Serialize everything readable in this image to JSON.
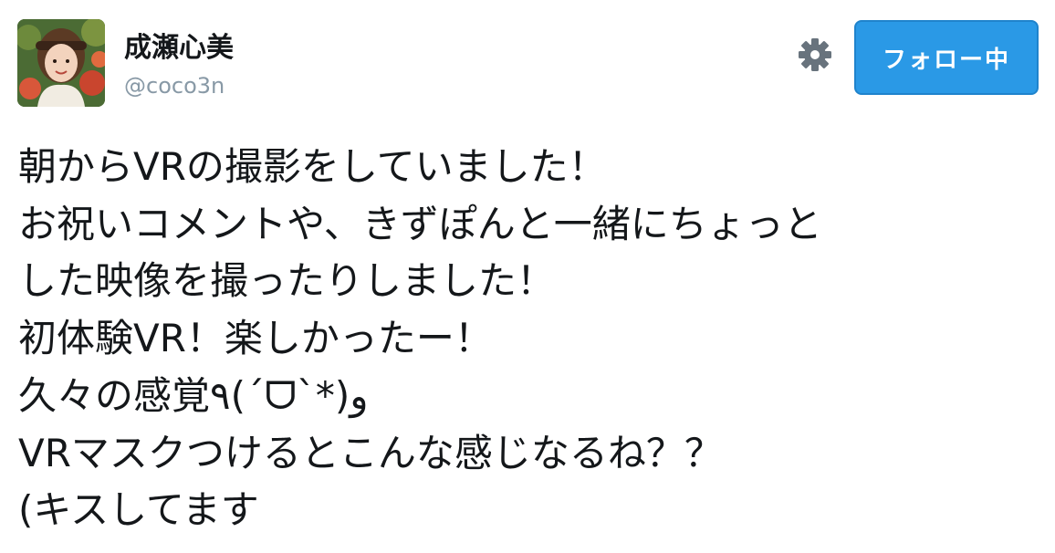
{
  "profile": {
    "display_name": "成瀬心美",
    "handle": "@coco3n"
  },
  "actions": {
    "settings_icon": "gear-icon",
    "follow_label": "フォロー中"
  },
  "tweet": {
    "lines": [
      "朝からVRの撮影をしていました！",
      "お祝いコメントや、きずぽんと一緒にちょっと",
      "した映像を撮ったりしました！",
      "初体験VR！楽しかったー！",
      "久々の感覚٩(ˊᗜˋ*)و",
      "VRマスクつけるとこんな感じなるね？？",
      "(キスしてます"
    ]
  },
  "colors": {
    "follow_button": "#2a99e6",
    "handle_text": "#8899a6",
    "body_text": "#14171a"
  }
}
